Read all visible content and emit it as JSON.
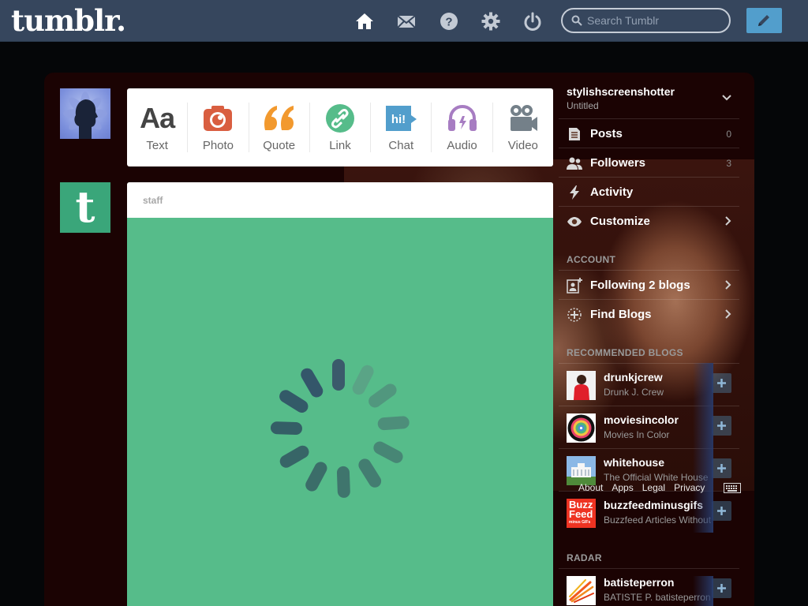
{
  "header": {
    "logo": "tumblr.",
    "search_placeholder": "Search Tumblr",
    "nav_icons": [
      "home-icon",
      "mail-icon",
      "help-icon",
      "settings-icon",
      "power-icon"
    ],
    "compose_icon": "pencil-icon",
    "bar_color": "#36465d",
    "accent_color": "#529ecc"
  },
  "post_types": [
    {
      "label": "Text",
      "icon": "text-icon",
      "color": "#444444"
    },
    {
      "label": "Photo",
      "icon": "camera-icon",
      "color": "#d95e40"
    },
    {
      "label": "Quote",
      "icon": "quote-icon",
      "color": "#f2992e"
    },
    {
      "label": "Link",
      "icon": "link-icon",
      "color": "#56bc8a"
    },
    {
      "label": "Chat",
      "icon": "chat-icon",
      "color": "#529ecc",
      "icon_text": "hi!"
    },
    {
      "label": "Audio",
      "icon": "headphones-icon",
      "color": "#a77dc2"
    },
    {
      "label": "Video",
      "icon": "video-camera-icon",
      "color": "#748089"
    }
  ],
  "post": {
    "author": "staff",
    "body_color": "#56bc8a",
    "loading_icon": "spinner-icon"
  },
  "sidebar": {
    "blog_name": "stylishscreenshotter",
    "blog_title": "Untitled",
    "menu": [
      {
        "label": "Posts",
        "icon": "posts-icon",
        "count": "0"
      },
      {
        "label": "Followers",
        "icon": "followers-icon",
        "count": "3"
      },
      {
        "label": "Activity",
        "icon": "lightning-icon"
      },
      {
        "label": "Customize",
        "icon": "eye-icon"
      }
    ],
    "account_heading": "ACCOUNT",
    "account": [
      {
        "label": "Following 2 blogs",
        "icon": "following-icon"
      },
      {
        "label": "Find Blogs",
        "icon": "find-blogs-icon"
      }
    ],
    "recommended_heading": "RECOMMENDED BLOGS",
    "recommended": [
      {
        "name": "drunkjcrew",
        "subtitle": "Drunk J. Crew"
      },
      {
        "name": "moviesincolor",
        "subtitle": "Movies In Color"
      },
      {
        "name": "whitehouse",
        "subtitle": "The Official White House"
      },
      {
        "name": "buzzfeedminusgifs",
        "subtitle": "Buzzfeed Articles Without GIFs",
        "thumb_text_1": "Buzz",
        "thumb_text_2": "Feed",
        "thumb_text_3": "minus GIFs"
      }
    ],
    "radar_heading": "RADAR",
    "radar": [
      {
        "name": "batisteperron",
        "subtitle": "BATISTE P. batisteperron"
      }
    ]
  },
  "footer": {
    "links": [
      "About",
      "Apps",
      "Legal",
      "Privacy"
    ],
    "keyboard_icon": "keyboard-icon"
  }
}
